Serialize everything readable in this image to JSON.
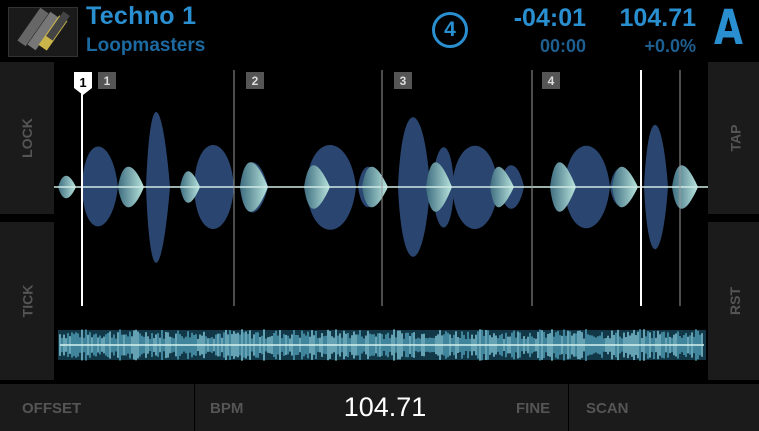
{
  "header": {
    "track_title": "Techno 1",
    "artist": "Loopmasters",
    "beat_counter": "4",
    "time_remaining": "-04:01",
    "time_elapsed": "00:00",
    "bpm": "104.71",
    "pitch": "+0.0%",
    "deck_letter": "A"
  },
  "side_buttons": {
    "left_top": "LOCK",
    "left_bottom": "TICK",
    "right_top": "TAP",
    "right_bottom": "RST"
  },
  "waveform": {
    "beat_markers": [
      "1",
      "2",
      "3",
      "4"
    ],
    "cue_label": "1"
  },
  "footer": {
    "offset_label": "OFFSET",
    "bpm_label": "BPM",
    "bpm_value": "104.71",
    "fine_label": "FINE",
    "scan_label": "SCAN"
  },
  "colors": {
    "accent_blue": "#2a8fd0",
    "wave_body": "#2a4670",
    "wave_transient": "#a8d8d4",
    "overview": "#7fc6d8"
  }
}
